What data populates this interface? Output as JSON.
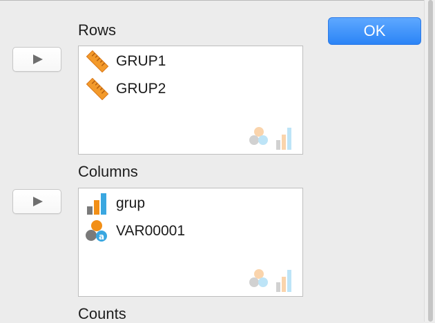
{
  "dialog": {
    "ok_label": "OK",
    "accent_color": "#2f88f8"
  },
  "rows": {
    "label": "Rows",
    "move_button_icon": "play-triangle-icon",
    "items": [
      {
        "name": "GRUP1",
        "icon": "ruler-scale-icon"
      },
      {
        "name": "GRUP2",
        "icon": "ruler-scale-icon"
      }
    ],
    "watermark_icon": "measure-types-watermark-icon"
  },
  "columns": {
    "label": "Columns",
    "move_button_icon": "play-triangle-icon",
    "items": [
      {
        "name": "grup",
        "icon": "ordinal-bars-icon"
      },
      {
        "name": "VAR00001",
        "icon": "nominal-string-icon"
      }
    ],
    "watermark_icon": "measure-types-watermark-icon"
  },
  "counts": {
    "label": "Counts"
  }
}
